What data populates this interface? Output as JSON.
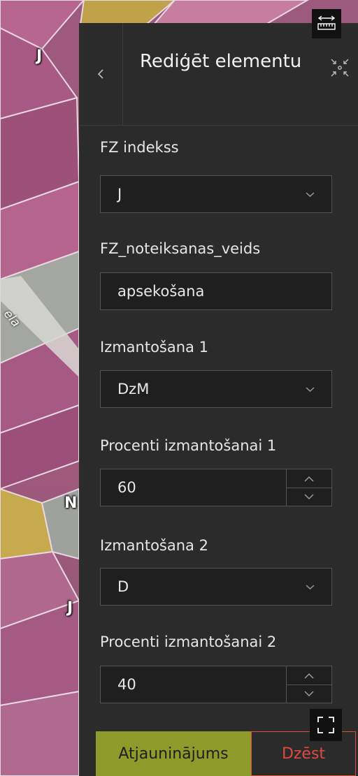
{
  "map": {
    "labels": [
      "J",
      "N",
      "J"
    ],
    "street_fragment": "ela"
  },
  "panel": {
    "back_icon": "chevron-left-icon",
    "title": "Rediģēt elementu",
    "collapse_icon": "collapse-arrows-icon"
  },
  "fields": {
    "fz_indekss": {
      "label": "FZ indekss",
      "value": "J"
    },
    "fz_noteiksanas_veids": {
      "label": "FZ_noteiksanas_veids",
      "value": "apsekošana"
    },
    "izmantosana_1": {
      "label": "Izmantošana 1",
      "value": "DzM"
    },
    "procenti_1": {
      "label": "Procenti izmantošanai 1",
      "value": "60"
    },
    "izmantosana_2": {
      "label": "Izmantošana 2",
      "value": "D"
    },
    "procenti_2": {
      "label": "Procenti izmantošanai 2",
      "value": "40"
    }
  },
  "footer": {
    "update_label": "Atjauninājums",
    "delete_label": "Dzēst"
  },
  "tools": {
    "measure_icon": "measure-icon",
    "fullscreen_icon": "fullscreen-icon"
  },
  "colors": {
    "panel_bg": "#2b2b2b",
    "update_button": "#8e9a2a",
    "delete_accent": "#e0493c"
  }
}
